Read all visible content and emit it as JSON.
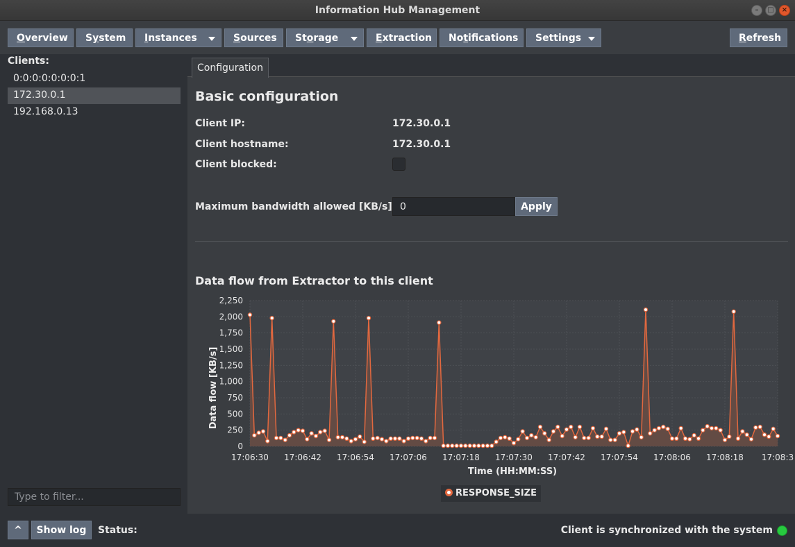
{
  "window": {
    "title": "Information Hub Management"
  },
  "menu": {
    "overview": {
      "pre": "",
      "u": "O",
      "post": "verview"
    },
    "system": {
      "pre": "S",
      "u": "y",
      "post": "stem"
    },
    "instances": {
      "pre": "",
      "u": "I",
      "post": "nstances"
    },
    "sources": {
      "pre": "",
      "u": "S",
      "post": "ources"
    },
    "storage": {
      "pre": "St",
      "u": "o",
      "post": "rage"
    },
    "extraction": {
      "pre": "",
      "u": "E",
      "post": "xtraction"
    },
    "notifications": {
      "pre": "No",
      "u": "t",
      "post": "ifications"
    },
    "settings": {
      "label": "Settings"
    },
    "refresh": {
      "pre": "",
      "u": "R",
      "post": "efresh"
    }
  },
  "sidebar": {
    "header": "Clients:",
    "clients": [
      "0:0:0:0:0:0:0:1",
      "172.30.0.1",
      "192.168.0.13"
    ],
    "selected_index": 1,
    "filter_placeholder": "Type to filter..."
  },
  "tabs": {
    "configuration": "Configuration"
  },
  "config": {
    "title": "Basic configuration",
    "client_ip_label": "Client IP:",
    "client_ip": "172.30.0.1",
    "hostname_label": "Client hostname:",
    "hostname": "172.30.0.1",
    "blocked_label": "Client blocked:",
    "blocked": false,
    "bandwidth_label": "Maximum bandwidth allowed [KB/s]:",
    "bandwidth_value": "0",
    "apply_label": "Apply"
  },
  "chart_section": {
    "title": "Data flow from Extractor to this client"
  },
  "chart_data": {
    "type": "area",
    "xlabel": "Time (HH:MM:SS)",
    "ylabel": "Data flow [KB/s]",
    "ylim": [
      0,
      2250
    ],
    "yticks": [
      0,
      250,
      500,
      750,
      1000,
      1250,
      1500,
      1750,
      2000,
      2250
    ],
    "ytick_labels": [
      "0",
      "250",
      "500",
      "750",
      "1,000",
      "1,250",
      "1,500",
      "1,750",
      "2,000",
      "2,250"
    ],
    "xtick_labels": [
      "17:06:30",
      "17:06:42",
      "17:06:54",
      "17:07:06",
      "17:07:18",
      "17:07:30",
      "17:07:42",
      "17:07:54",
      "17:08:06",
      "17:08:18",
      "17:08:3"
    ],
    "grid": true,
    "legend_position": "bottom",
    "series": [
      {
        "name": "RESPONSE_SIZE",
        "color": "#e2683f",
        "values": [
          2030,
          170,
          210,
          230,
          80,
          1980,
          130,
          130,
          100,
          170,
          220,
          250,
          240,
          110,
          200,
          160,
          220,
          240,
          100,
          1930,
          140,
          140,
          120,
          80,
          110,
          150,
          70,
          1980,
          120,
          130,
          110,
          80,
          120,
          120,
          120,
          80,
          120,
          130,
          130,
          120,
          80,
          130,
          130,
          1910,
          10,
          10,
          10,
          10,
          10,
          10,
          10,
          10,
          10,
          10,
          10,
          10,
          70,
          130,
          140,
          120,
          50,
          110,
          230,
          130,
          170,
          140,
          300,
          200,
          100,
          230,
          300,
          160,
          260,
          300,
          140,
          300,
          130,
          130,
          280,
          150,
          150,
          270,
          100,
          100,
          200,
          220,
          10,
          230,
          260,
          140,
          2110,
          200,
          250,
          280,
          300,
          270,
          120,
          120,
          280,
          120,
          110,
          170,
          120,
          250,
          310,
          280,
          280,
          250,
          100,
          150,
          2080,
          120,
          230,
          180,
          110,
          290,
          300,
          180,
          150,
          270,
          160
        ]
      }
    ]
  },
  "legend": {
    "label": "RESPONSE_SIZE"
  },
  "statusbar": {
    "up_label": "^",
    "show_log_label": "Show log",
    "status_label": "Status:",
    "sync_text": "Client is synchronized with the system",
    "sync_color": "#27c93f"
  }
}
